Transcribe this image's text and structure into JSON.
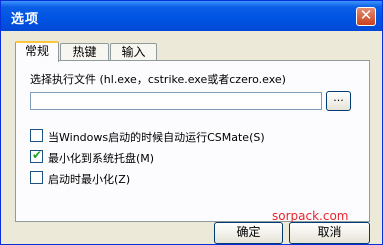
{
  "window": {
    "title": "选项",
    "close_symbol": "✕"
  },
  "tabs": [
    {
      "label": "常规"
    },
    {
      "label": "热键"
    },
    {
      "label": "输入"
    }
  ],
  "general": {
    "file_label": "选择执行文件 (hl.exe，cstrike.exe或者czero.exe)",
    "path_value": "",
    "browse_label": "...",
    "options": [
      {
        "label": "当Windows启动的时候自动运行CSMate(S)",
        "checked": false
      },
      {
        "label": "最小化到系统托盘(M)",
        "checked": true
      },
      {
        "label": "启动时最小化(Z)",
        "checked": false
      }
    ]
  },
  "buttons": {
    "ok": "确定",
    "cancel": "取消"
  },
  "watermark": "sorpack.com",
  "colors": {
    "titlebar": "#0054E3",
    "tab_highlight": "#FFC83C",
    "check": "#21A121",
    "watermark": "#E8252D"
  }
}
